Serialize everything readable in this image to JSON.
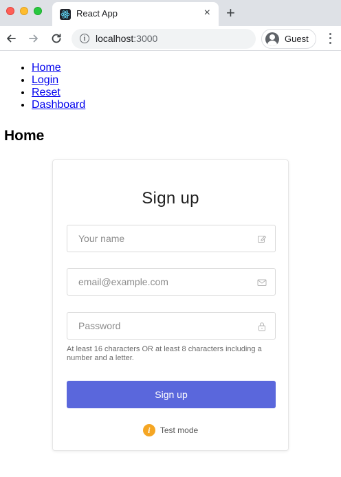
{
  "browser": {
    "tab_title": "React App",
    "tab_close": "×",
    "new_tab": "+",
    "url_host": "localhost",
    "url_port": ":3000",
    "profile_label": "Guest",
    "icons": [
      "back-arrow-icon",
      "forward-arrow-icon",
      "reload-icon",
      "info-icon",
      "react-logo-icon",
      "avatar-icon",
      "menu-dots-icon"
    ]
  },
  "nav": {
    "items": [
      "Home",
      "Login",
      "Reset",
      "Dashboard"
    ]
  },
  "page": {
    "title": "Home"
  },
  "signup": {
    "title": "Sign up",
    "name_placeholder": "Your name",
    "email_placeholder": "email@example.com",
    "password_placeholder": "Password",
    "hint": "At least 16 characters OR at least 8 characters including a number and a letter.",
    "submit_label": "Sign up",
    "test_mode_label": "Test mode",
    "test_mode_glyph": "i",
    "accent_color": "#5a67dc",
    "test_mode_color": "#f5a623"
  }
}
